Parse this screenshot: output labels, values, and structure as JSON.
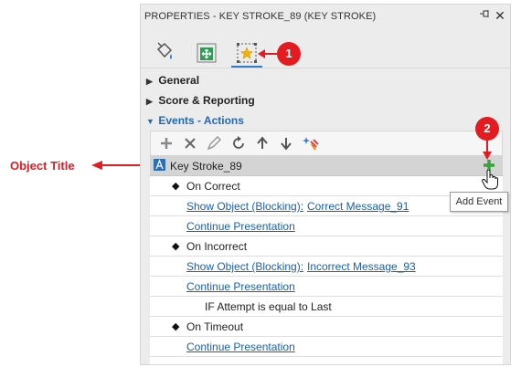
{
  "panel": {
    "title": "PROPERTIES - KEY STROKE_89 (KEY STROKE)",
    "pin_icon": "pin-icon",
    "close_icon": "close-icon",
    "close_glyph": "✕"
  },
  "tabs": [
    {
      "name": "format-tab",
      "icon": "paint-bucket-icon"
    },
    {
      "name": "size-position-tab",
      "icon": "move-icon"
    },
    {
      "name": "events-actions-tab",
      "icon": "star-icon",
      "selected": true
    }
  ],
  "sections": [
    {
      "label": "General",
      "expanded": false,
      "tri": "▶"
    },
    {
      "label": "Score & Reporting",
      "expanded": false,
      "tri": "▶"
    },
    {
      "label": "Events - Actions",
      "expanded": true,
      "tri": "▼"
    }
  ],
  "toolbar": [
    {
      "name": "add-icon"
    },
    {
      "name": "delete-icon"
    },
    {
      "name": "edit-icon"
    },
    {
      "name": "refresh-icon"
    },
    {
      "name": "move-up-icon"
    },
    {
      "name": "move-down-icon"
    },
    {
      "name": "sparkle-icon"
    }
  ],
  "object_row": {
    "title": "Key Stroke_89",
    "icon": "key-stroke-icon",
    "add_icon": "plus-icon"
  },
  "events": [
    {
      "event": "On Correct"
    },
    {
      "action": "Show Object (Blocking):",
      "target": "Correct Message_91"
    },
    {
      "action": "Continue Presentation"
    },
    {
      "event": "On Incorrect"
    },
    {
      "action": "Show Object (Blocking):",
      "target": "Incorrect Message_93"
    },
    {
      "action": "Continue Presentation"
    },
    {
      "condition": "IF Attempt is equal to Last"
    },
    {
      "event": "On Timeout"
    },
    {
      "action": "Continue Presentation"
    }
  ],
  "tooltip": "Add Event",
  "annotations": {
    "object_title": "Object Title",
    "badge1": "1",
    "badge2": "2"
  },
  "colors": {
    "accent": "#2e7bd1",
    "link": "#1a5fb4",
    "annotation_red": "#e41c22",
    "add_green": "#3aa23a",
    "selected_row": "#d4d4d4"
  }
}
